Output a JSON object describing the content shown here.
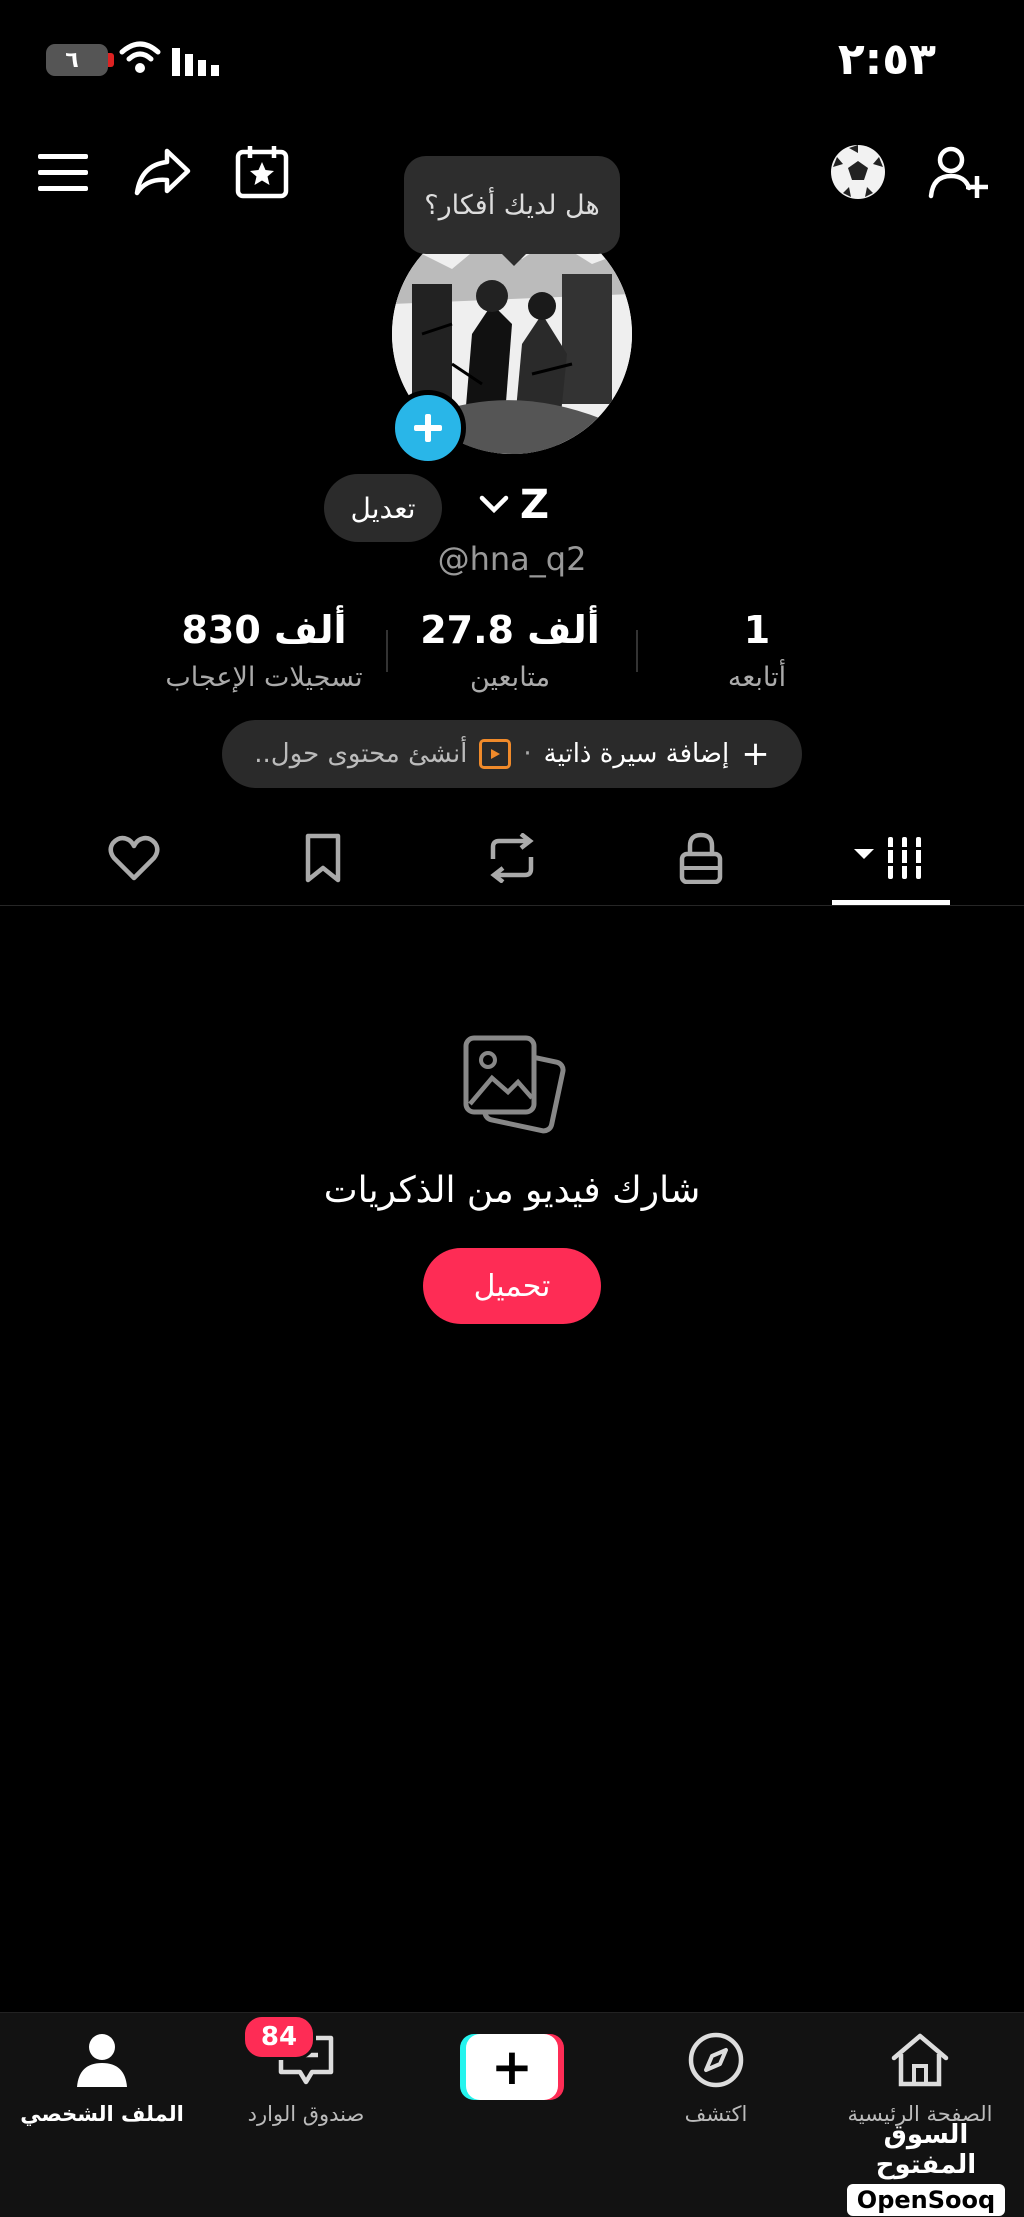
{
  "status_bar": {
    "time": "٢:٥٣",
    "battery": "٦"
  },
  "header": {
    "icons": [
      "menu-icon",
      "share-icon",
      "calendar-star-icon",
      "soccer-ball-icon",
      "add-friend-icon"
    ],
    "tooltip": "هل لديك أفكار؟"
  },
  "profile": {
    "name": "Z",
    "handle": "@hna_q2",
    "edit_label": "تعديل"
  },
  "stats": [
    {
      "value": "1",
      "label": "أتابعه"
    },
    {
      "value": "27.8 ألف",
      "label": "متابعين"
    },
    {
      "value": "830 ألف",
      "label": "تسجيلات الإعجاب"
    }
  ],
  "bio": {
    "add_label": "إضافة سيرة ذاتية",
    "suggestion": "أنشئ محتوى حول.."
  },
  "tabs": [
    "videos-grid-icon",
    "lock-icon",
    "repost-icon",
    "bookmark-icon",
    "heart-icon"
  ],
  "empty_state": {
    "message": "شارك فيديو من الذكريات",
    "button": "تحميل"
  },
  "bottom_nav": {
    "home": "الصفحة الرئيسية",
    "discover": "اكتشف",
    "inbox": "صندوق الوارد",
    "inbox_badge": "84",
    "profile": "الملف الشخصي"
  },
  "watermark": {
    "arabic": "السوق المفتوح",
    "english": "OpenSooq"
  },
  "colors": {
    "accent": "#fe2c55",
    "cyan": "#25f4ee",
    "avatar_add": "#29b6e8"
  }
}
